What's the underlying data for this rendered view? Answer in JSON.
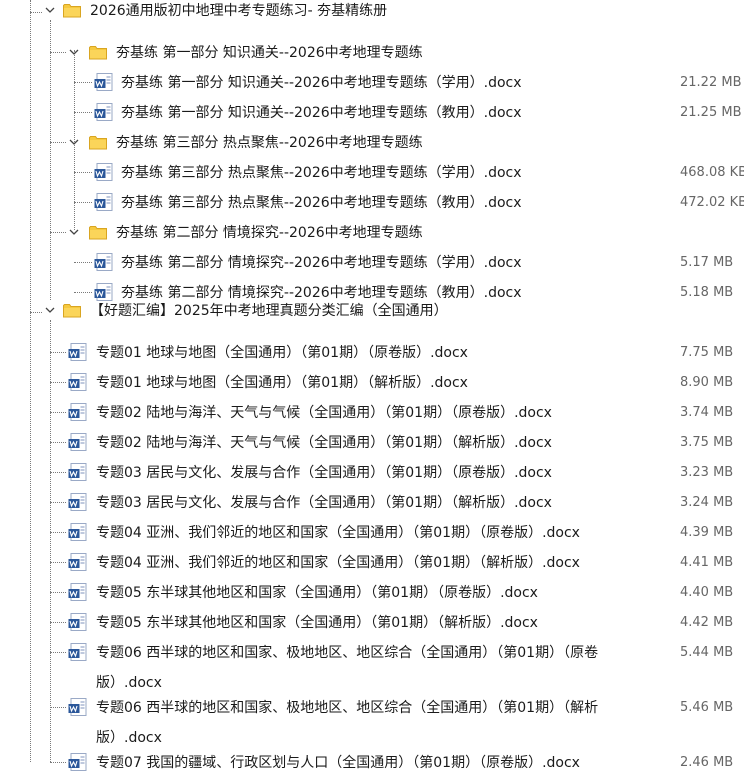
{
  "root": {
    "label": "2026通用版初中地理中考专题练习- 夯基精练册",
    "groups": [
      {
        "label": "夯基练 第一部分 知识通关--2026中考地理专题练",
        "files": [
          {
            "name": "夯基练 第一部分 知识通关--2026中考地理专题练（学用）.docx",
            "size": "21.22 MB"
          },
          {
            "name": "夯基练 第一部分 知识通关--2026中考地理专题练（教用）.docx",
            "size": "21.25 MB"
          }
        ]
      },
      {
        "label": "夯基练 第三部分 热点聚焦--2026中考地理专题练",
        "files": [
          {
            "name": "夯基练 第三部分 热点聚焦--2026中考地理专题练（学用）.docx",
            "size": "468.08 KB"
          },
          {
            "name": "夯基练 第三部分 热点聚焦--2026中考地理专题练（教用）.docx",
            "size": "472.02 KB"
          }
        ]
      },
      {
        "label": "夯基练 第二部分 情境探究--2026中考地理专题练",
        "files": [
          {
            "name": "夯基练 第二部分 情境探究--2026中考地理专题练（学用）.docx",
            "size": "5.17 MB"
          },
          {
            "name": "夯基练 第二部分 情境探究--2026中考地理专题练（教用）.docx",
            "size": "5.18 MB"
          }
        ]
      }
    ]
  },
  "root2": {
    "label": "【好题汇编】2025年中考地理真题分类汇编（全国通用）",
    "files": [
      {
        "name": "专题01 地球与地图（全国通用）（第01期）（原卷版）.docx",
        "size": "7.75 MB"
      },
      {
        "name": "专题01 地球与地图（全国通用）（第01期）（解析版）.docx",
        "size": "8.90 MB"
      },
      {
        "name": "专题02 陆地与海洋、天气与气候（全国通用）（第01期）（原卷版）.docx",
        "size": "3.74 MB"
      },
      {
        "name": "专题02 陆地与海洋、天气与气候（全国通用）（第01期）（解析版）.docx",
        "size": "3.75 MB"
      },
      {
        "name": "专题03 居民与文化、发展与合作（全国通用）（第01期）（原卷版）.docx",
        "size": "3.23 MB"
      },
      {
        "name": "专题03 居民与文化、发展与合作（全国通用）（第01期）（解析版）.docx",
        "size": "3.24 MB"
      },
      {
        "name": "专题04 亚洲、我们邻近的地区和国家（全国通用）（第01期）（原卷版）.docx",
        "size": "4.39 MB"
      },
      {
        "name": "专题04 亚洲、我们邻近的地区和国家（全国通用）（第01期）（解析版）.docx",
        "size": "4.41 MB"
      },
      {
        "name": "专题05 东半球其他地区和国家（全国通用）（第01期）（原卷版）.docx",
        "size": "4.40 MB"
      },
      {
        "name": "专题05 东半球其他地区和国家（全国通用）（第01期）（解析版）.docx",
        "size": "4.42 MB"
      },
      {
        "name": "专题06 西半球的地区和国家、极地地区、地区综合（全国通用）（第01期）（原卷版）.docx",
        "size": "5.44 MB"
      },
      {
        "name": "专题06 西半球的地区和国家、极地地区、地区综合（全国通用）（第01期）（解析版）.docx",
        "size": "5.46 MB"
      },
      {
        "name": "专题07 我国的疆域、行政区划与人口（全国通用）（第01期）（原卷版）.docx",
        "size": "2.46 MB"
      }
    ]
  },
  "icons": {
    "folder": "folder-icon",
    "document": "word-document-icon",
    "expand": "chevron-down-icon"
  },
  "colors": {
    "folder": "#f4c430",
    "doc_blue": "#2b579a"
  }
}
